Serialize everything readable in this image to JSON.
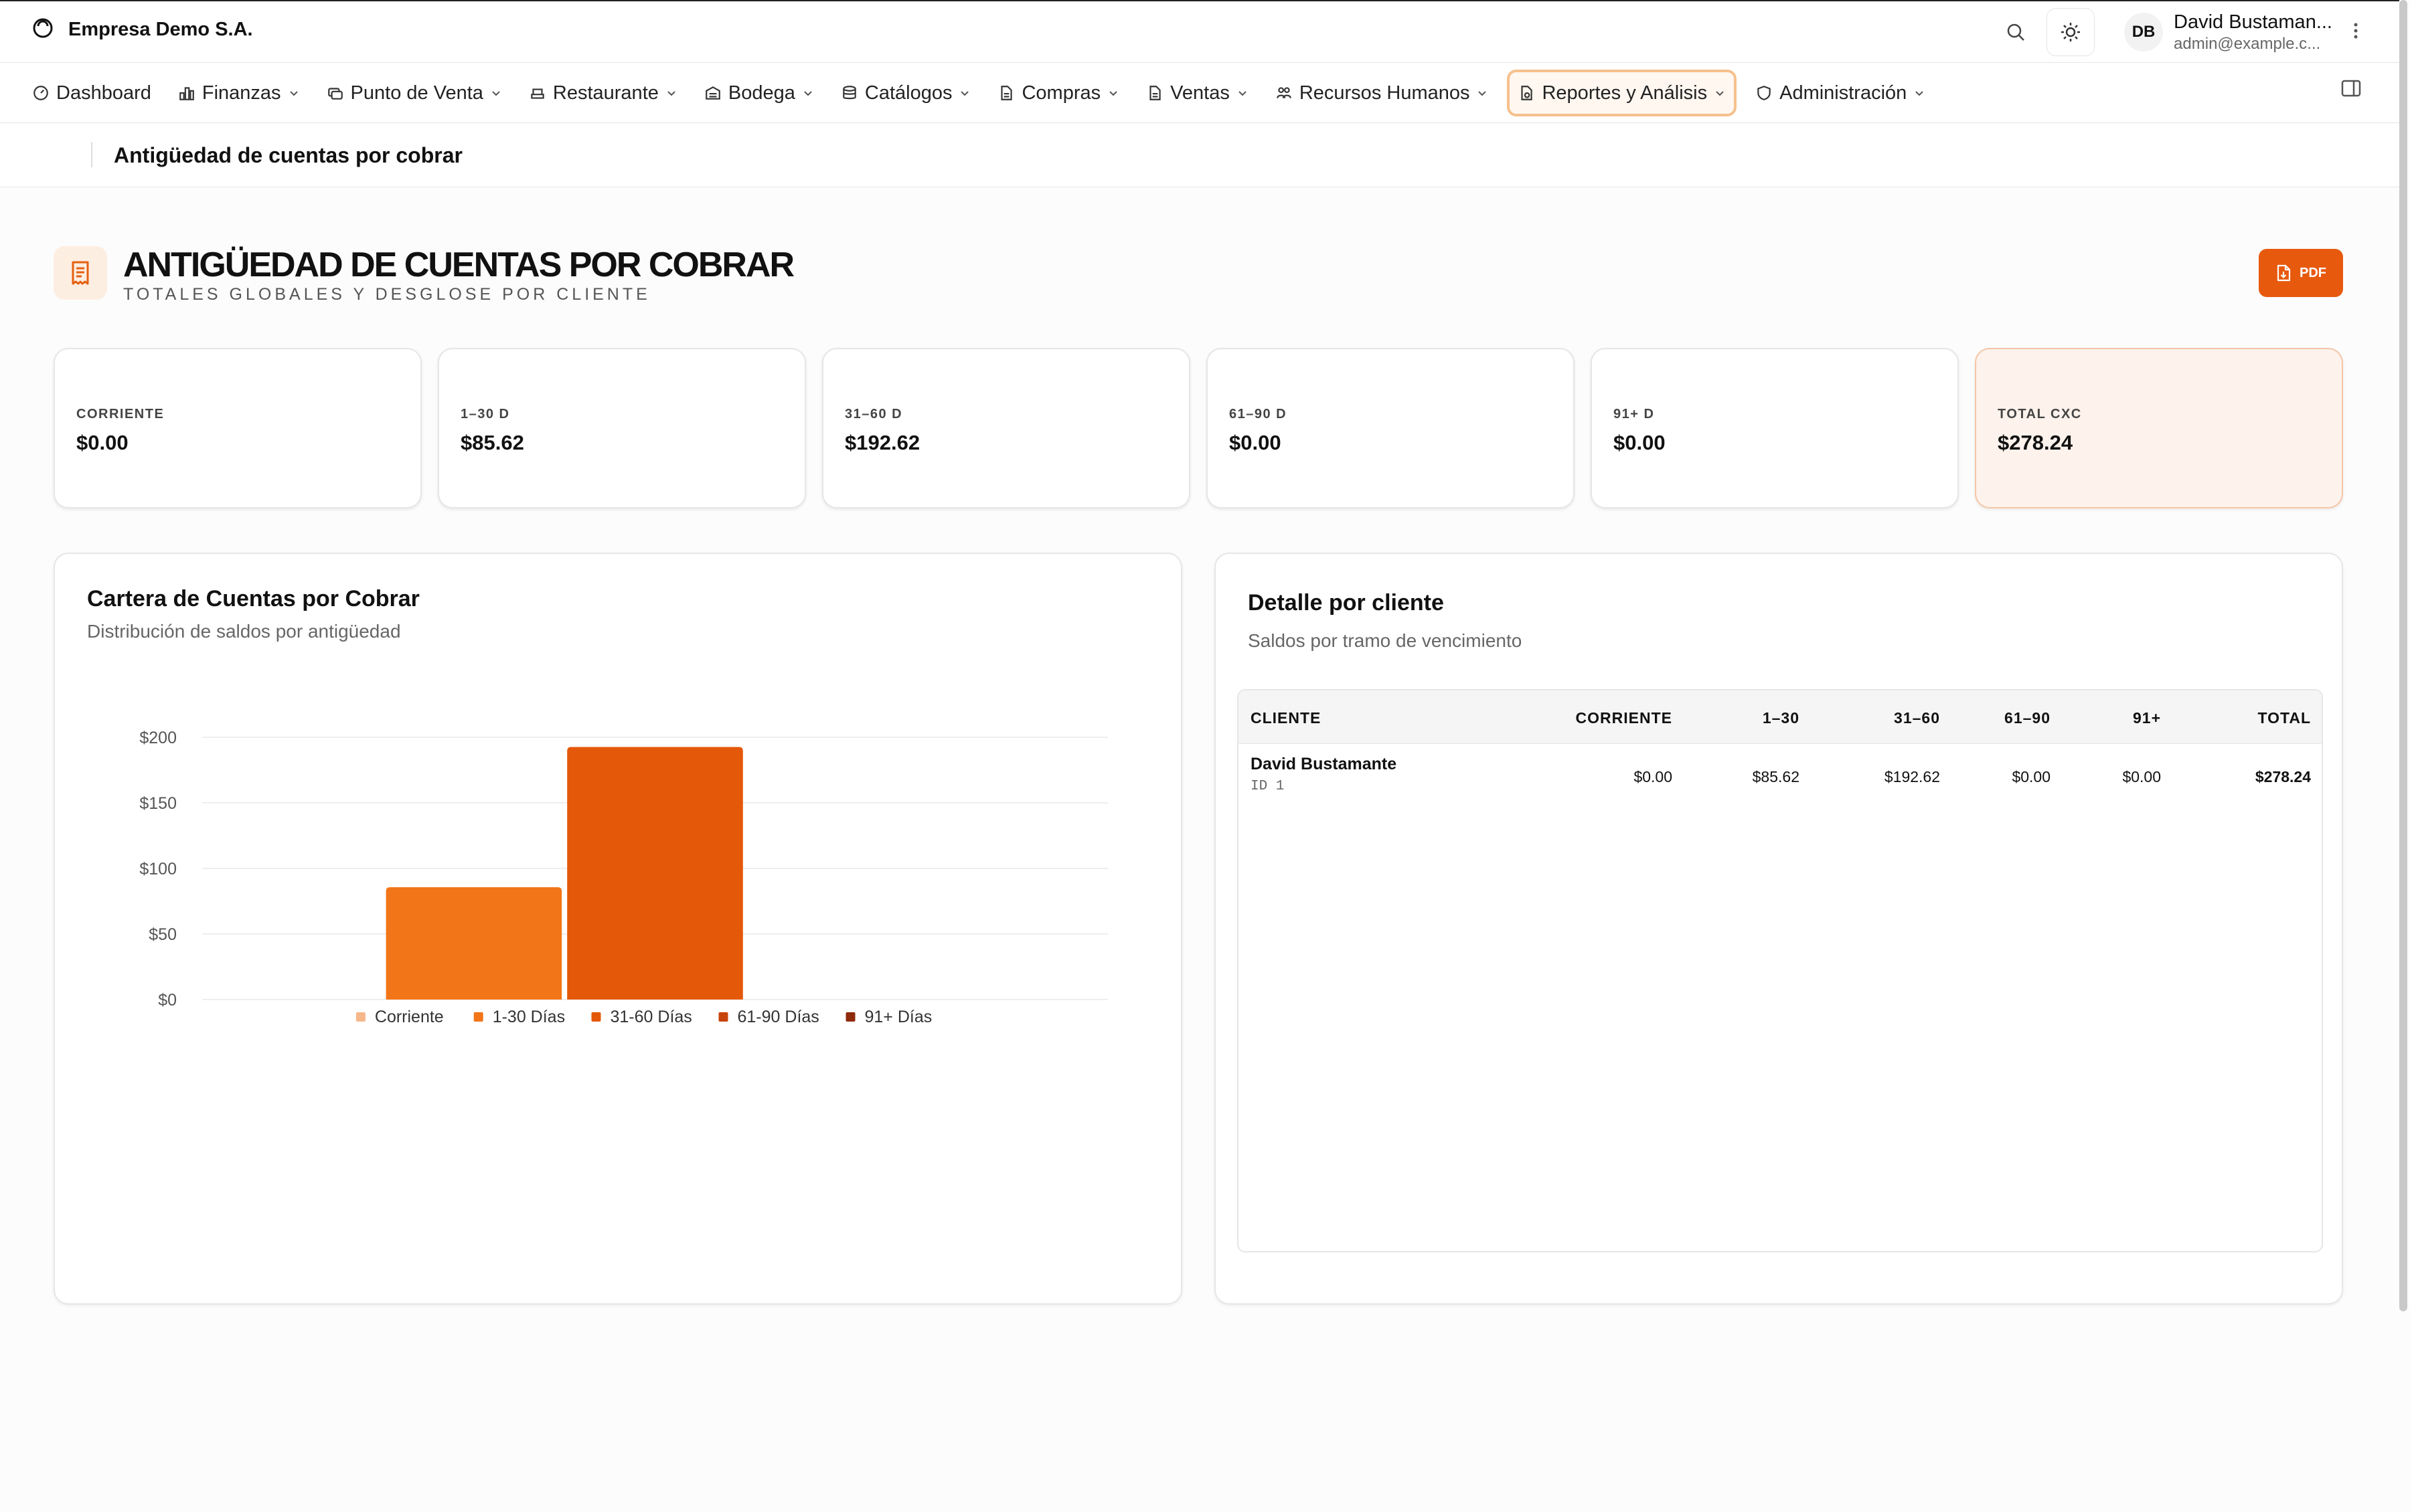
{
  "company": {
    "name": "Empresa Demo S.A."
  },
  "user": {
    "initials": "DB",
    "name": "David Bustaman...",
    "email": "admin@example.c..."
  },
  "nav": {
    "items": [
      {
        "label": "Dashboard",
        "icon": "gauge-icon",
        "dropdown": false
      },
      {
        "label": "Finanzas",
        "icon": "bar-chart-icon",
        "dropdown": true
      },
      {
        "label": "Punto de Venta",
        "icon": "register-icon",
        "dropdown": true
      },
      {
        "label": "Restaurante",
        "icon": "restaurant-icon",
        "dropdown": true
      },
      {
        "label": "Bodega",
        "icon": "warehouse-icon",
        "dropdown": true
      },
      {
        "label": "Catálogos",
        "icon": "database-icon",
        "dropdown": true
      },
      {
        "label": "Compras",
        "icon": "document-icon",
        "dropdown": true
      },
      {
        "label": "Ventas",
        "icon": "document-icon",
        "dropdown": true
      },
      {
        "label": "Recursos Humanos",
        "icon": "people-icon",
        "dropdown": true
      },
      {
        "label": "Reportes y Análisis",
        "icon": "report-icon",
        "dropdown": true,
        "active": true
      },
      {
        "label": "Administración",
        "icon": "shield-icon",
        "dropdown": true
      }
    ]
  },
  "breadcrumb": {
    "title": "Antigüedad de cuentas por cobrar"
  },
  "page": {
    "title": "ANTIGÜEDAD DE CUENTAS POR COBRAR",
    "subtitle": "TOTALES GLOBALES Y DESGLOSE POR CLIENTE",
    "pdf_label": "PDF"
  },
  "summary_cards": [
    {
      "label": "CORRIENTE",
      "value": "$0.00"
    },
    {
      "label": "1–30 D",
      "value": "$85.62"
    },
    {
      "label": "31–60 D",
      "value": "$192.62"
    },
    {
      "label": "61–90 D",
      "value": "$0.00"
    },
    {
      "label": "91+ D",
      "value": "$0.00"
    },
    {
      "label": "TOTAL CXC",
      "value": "$278.24",
      "highlight": true
    }
  ],
  "chart_panel": {
    "title": "Cartera de Cuentas por Cobrar",
    "subtitle": "Distribución de saldos por antigüedad"
  },
  "chart_data": {
    "type": "bar",
    "categories": [
      "Corriente",
      "1-30 Días",
      "31-60 Días",
      "61-90 Días",
      "91+ Días"
    ],
    "values": [
      0,
      85.62,
      192.62,
      0,
      0
    ],
    "colors": [
      "#f6b78c",
      "#f27518",
      "#e4580a",
      "#c7420c",
      "#8e2c0c"
    ],
    "yticks": [
      "$0",
      "$50",
      "$100",
      "$150",
      "$200"
    ],
    "ylim": [
      0,
      200
    ],
    "legend_position": "bottom",
    "grid": true
  },
  "table_panel": {
    "title": "Detalle por cliente",
    "subtitle": "Saldos por tramo de vencimiento",
    "headers": [
      "CLIENTE",
      "CORRIENTE",
      "1–30",
      "31–60",
      "61–90",
      "91+",
      "TOTAL"
    ],
    "rows": [
      {
        "name": "David Bustamante",
        "id": "ID 1",
        "corriente": "$0.00",
        "d1_30": "$85.62",
        "d31_60": "$192.62",
        "d61_90": "$0.00",
        "d91": "$0.00",
        "total": "$278.24"
      }
    ]
  }
}
